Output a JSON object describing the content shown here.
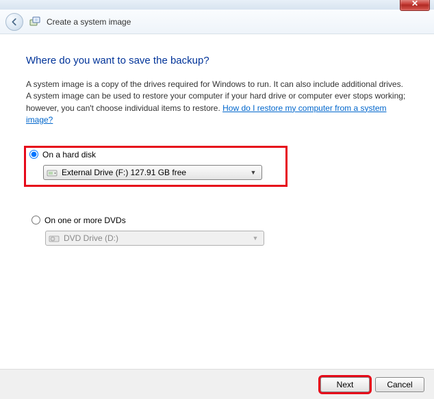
{
  "window": {
    "title": "Create a system image"
  },
  "page": {
    "heading": "Where do you want to save the backup?",
    "description": "A system image is a copy of the drives required for Windows to run. It can also include additional drives. A system image can be used to restore your computer if your hard drive or computer ever stops working; however, you can't choose individual items to restore. ",
    "help_link_text": "How do I restore my computer from a system image?"
  },
  "options": {
    "hard_disk": {
      "label": "On a hard disk",
      "selected": "External Drive (F:)  127.91 GB free"
    },
    "dvd": {
      "label": "On one or more DVDs",
      "selected": "DVD Drive (D:)"
    }
  },
  "footer": {
    "next": "Next",
    "cancel": "Cancel"
  }
}
